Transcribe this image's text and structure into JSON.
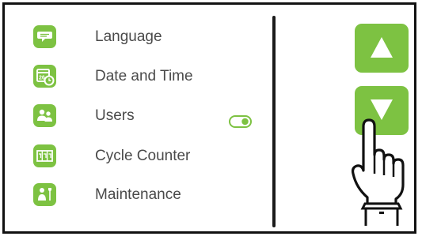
{
  "menu": {
    "items": [
      {
        "label": "Language",
        "icon": "speech-bubble-icon"
      },
      {
        "label": "Date and Time",
        "icon": "calendar-clock-icon"
      },
      {
        "label": "Users",
        "icon": "users-icon"
      },
      {
        "label": "Cycle Counter",
        "icon": "counter-icon"
      },
      {
        "label": "Maintenance",
        "icon": "wrench-icon"
      }
    ]
  },
  "users_toggle": {
    "state": "on"
  },
  "scroll": {
    "up_icon": "arrow-up-icon",
    "down_icon": "arrow-down-icon"
  },
  "cursor": {
    "icon": "pointing-hand-icon"
  },
  "colors": {
    "accent": "#7dc242",
    "text": "#4a4a4a",
    "frame": "#111111"
  }
}
